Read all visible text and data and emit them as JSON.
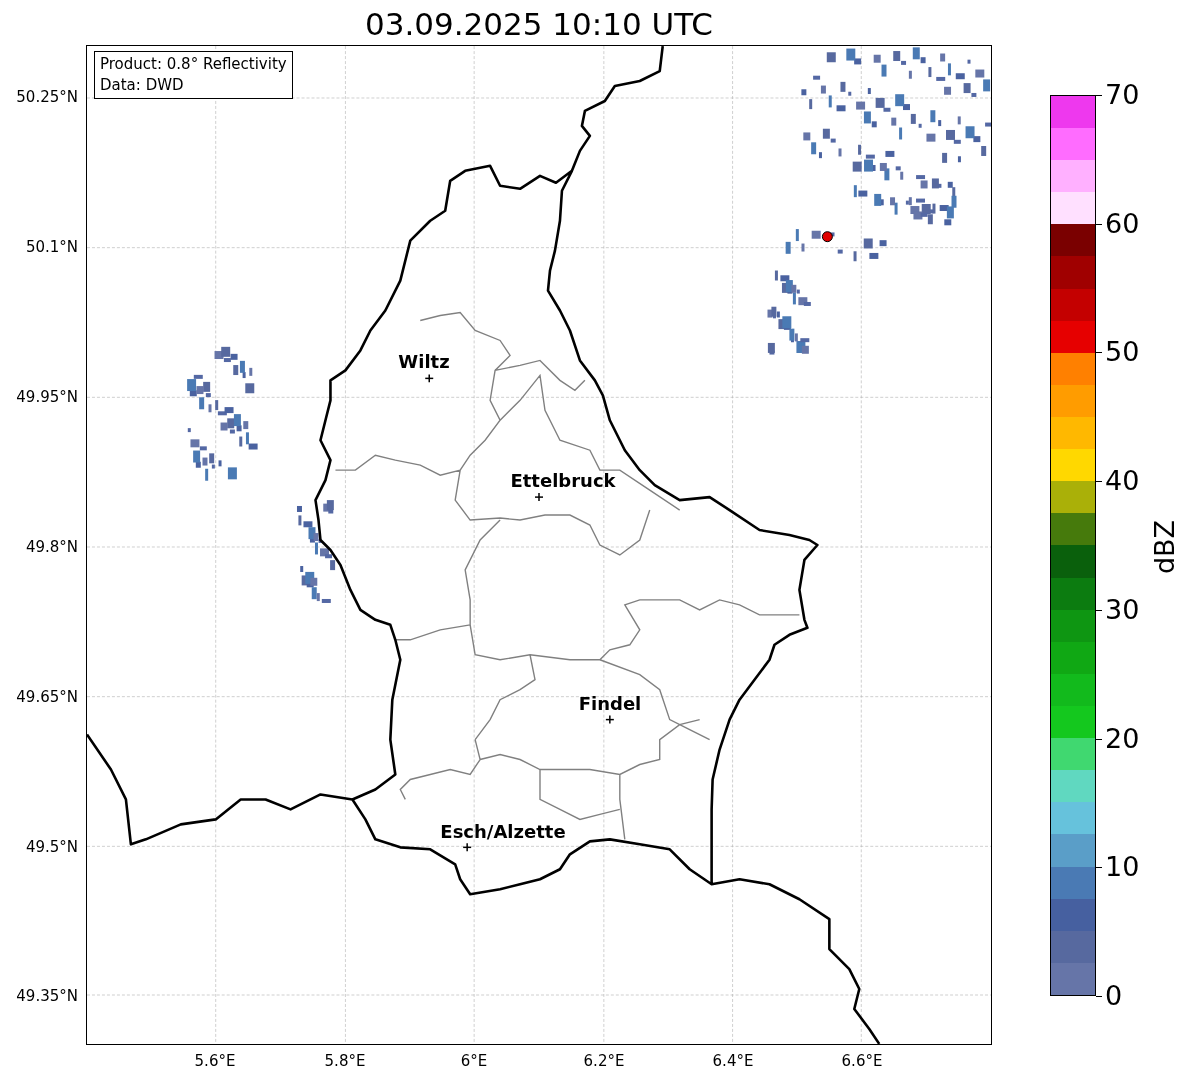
{
  "title": "03.09.2025 10:10 UTC",
  "info_box": {
    "lines": [
      "Product: 0.8° Reflectivity",
      "Data: DWD"
    ]
  },
  "map": {
    "lat_labels": [
      "50.25°N",
      "50.1°N",
      "49.95°N",
      "49.8°N",
      "49.65°N",
      "49.5°N",
      "49.35°N"
    ],
    "lon_labels": [
      "5.6°E",
      "5.8°E",
      "6°E",
      "6.2°E",
      "6.4°E",
      "6.6°E"
    ],
    "cities": [
      {
        "name": "Wiltz"
      },
      {
        "name": "Ettelbruck"
      },
      {
        "name": "Findel"
      },
      {
        "name": "Esch/Alzette"
      }
    ]
  },
  "colorbar": {
    "label": "dBZ",
    "ticks": [
      "70",
      "60",
      "50",
      "40",
      "30",
      "20",
      "10",
      "0"
    ],
    "bins": [
      {
        "color": "#6675a8"
      },
      {
        "color": "#57699f"
      },
      {
        "color": "#4660a0"
      },
      {
        "color": "#4a7ab4"
      },
      {
        "color": "#5a9ec8"
      },
      {
        "color": "#66c2dc"
      },
      {
        "color": "#60d8c0"
      },
      {
        "color": "#40d870"
      },
      {
        "color": "#14c81e"
      },
      {
        "color": "#12ba1c"
      },
      {
        "color": "#10a814"
      },
      {
        "color": "#0e9612"
      },
      {
        "color": "#0c7c10"
      },
      {
        "color": "#0a600c"
      },
      {
        "color": "#467a0c"
      },
      {
        "color": "#aab008"
      },
      {
        "color": "#ffd800"
      },
      {
        "color": "#ffb800"
      },
      {
        "color": "#ff9c00"
      },
      {
        "color": "#ff8000"
      },
      {
        "color": "#e60000"
      },
      {
        "color": "#c40000"
      },
      {
        "color": "#a00000"
      },
      {
        "color": "#7a0000"
      },
      {
        "color": "#ffe0ff"
      },
      {
        "color": "#ffb0ff"
      },
      {
        "color": "#ff6cff"
      },
      {
        "color": "#ee38ee"
      }
    ]
  }
}
